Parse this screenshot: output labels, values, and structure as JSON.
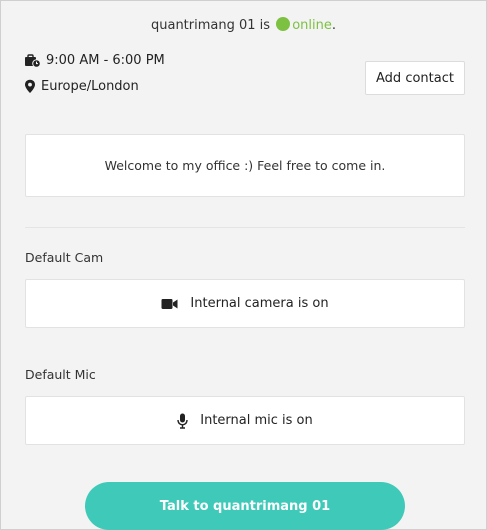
{
  "status": {
    "user": "quantrimang 01 is",
    "state": "online",
    "period": ".",
    "state_color": "#7dc142"
  },
  "info": {
    "hours": "9:00 AM - 6:00 PM",
    "timezone": "Europe/London",
    "hours_icon": "briefcase-clock-icon",
    "timezone_icon": "map-pin-icon"
  },
  "actions": {
    "add_contact": "Add contact",
    "talk": "Talk to quantrimang 01",
    "talk_color": "#3fc9b9"
  },
  "welcome": {
    "message": "Welcome to my office :) Feel free to come in."
  },
  "camera": {
    "label": "Default Cam",
    "status": "Internal camera is on",
    "icon": "video-camera-icon"
  },
  "mic": {
    "label": "Default Mic",
    "status": "Internal mic is on",
    "icon": "microphone-icon"
  }
}
